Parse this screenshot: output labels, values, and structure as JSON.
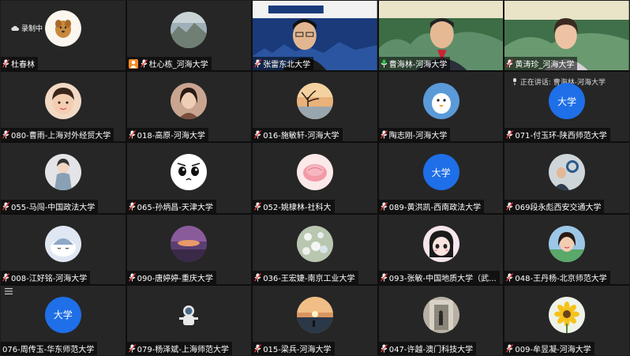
{
  "recording_label": "录制中",
  "speaking_label": "正在讲话: 曹海林-河海大学",
  "colors": {
    "tile_bg": "#262626",
    "avatar_blue": "#1e6fe8",
    "host_badge": "#f08c2a"
  },
  "tiles": [
    {
      "id": "t1",
      "name": "杜春林",
      "avatar": "dog-photo"
    },
    {
      "id": "t2",
      "name": "杜心栋_河海大学",
      "avatar": "landscape-photo",
      "host": true
    },
    {
      "id": "t3",
      "name": "张雷东北大学",
      "avatar": "video-man-glasses"
    },
    {
      "id": "t4",
      "name": "曹海林-河海大学",
      "avatar": "video-man-suit",
      "speaking": true
    },
    {
      "id": "t5",
      "name": "黄涛珍_河海大学",
      "avatar": "video-woman"
    },
    {
      "id": "t6",
      "name": "080-曹雨-上海对外经贸大学",
      "avatar": "child-photo"
    },
    {
      "id": "t7",
      "name": "018-高原-河海大学",
      "avatar": "girl-photo"
    },
    {
      "id": "t8",
      "name": "016-施敏轩-河海大学",
      "avatar": "sunset-tree-photo"
    },
    {
      "id": "t9",
      "name": "陶志刚-河海大学",
      "avatar": "cartoon-bird"
    },
    {
      "id": "t10",
      "name": "071-付玉环-陕西师范大学",
      "avatar": "text",
      "avatar_text": "大学"
    },
    {
      "id": "t11",
      "name": "055-马闯-中国政法大学",
      "avatar": "robot-figure"
    },
    {
      "id": "t12",
      "name": "065-孙炳昌-天津大学",
      "avatar": "cartoon-face"
    },
    {
      "id": "t13",
      "name": "052-姚棣林-社科大",
      "avatar": "flower-cake"
    },
    {
      "id": "t14",
      "name": "089-黄洪凯-西南政法大学",
      "avatar": "text",
      "avatar_text": "大学"
    },
    {
      "id": "t15",
      "name": "069段永彪西安交通大学",
      "avatar": "man-logo-photo"
    },
    {
      "id": "t16",
      "name": "008-江好铭-河海大学",
      "avatar": "cartoon-sleep"
    },
    {
      "id": "t17",
      "name": "090-唐婷婷-重庆大学",
      "avatar": "purple-sunset"
    },
    {
      "id": "t18",
      "name": "036-王宏婕-南京工业大学",
      "avatar": "flower-bush"
    },
    {
      "id": "t19",
      "name": "093-张敏-中国地质大学（武...",
      "avatar": "cartoon-girl"
    },
    {
      "id": "t20",
      "name": "048-王丹杨-北京师范大学",
      "avatar": "woman-photo"
    },
    {
      "id": "t21",
      "name": "076-周传玉-华东师范大学",
      "avatar": "text",
      "avatar_text": "大学",
      "menu": true
    },
    {
      "id": "t22",
      "name": "079-杨泽斌-上海师范大学",
      "avatar": "astronaut"
    },
    {
      "id": "t23",
      "name": "015-梁兵-河海大学",
      "avatar": "sunset-sea"
    },
    {
      "id": "t24",
      "name": "047-许越-澳门科技大学",
      "avatar": "hallway-person"
    },
    {
      "id": "t25",
      "name": "009-牟昱凝-河海大学",
      "avatar": "sunflower"
    }
  ]
}
